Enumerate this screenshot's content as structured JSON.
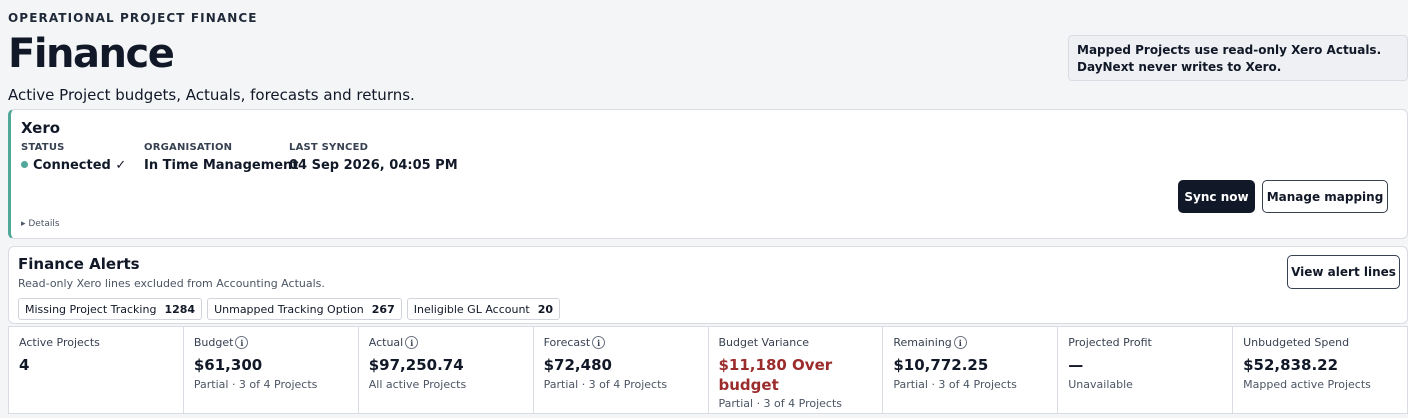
{
  "header": {
    "eyebrow": "OPERATIONAL PROJECT FINANCE",
    "title": "Finance",
    "subtitle": "Active Project budgets, Actuals, forecasts and returns.",
    "notice_line1": "Mapped Projects use read-only Xero Actuals.",
    "notice_line2": "DayNext never writes to Xero."
  },
  "xero": {
    "title": "Xero",
    "status_label": "STATUS",
    "status_value": "Connected ✓",
    "organisation_label": "ORGANISATION",
    "organisation_value": "In Time Management",
    "last_synced_label": "LAST SYNCED",
    "last_synced_value": "04 Sep 2026, 04:05 PM",
    "details_label": "▸ Details",
    "sync_button": "Sync now",
    "mapping_button": "Manage mapping",
    "accent_color": "#4fa89a"
  },
  "alerts": {
    "title": "Finance Alerts",
    "subtitle": "Read-only Xero lines excluded from Accounting Actuals.",
    "view_button": "View alert lines",
    "chips": [
      {
        "label": "Missing Project Tracking",
        "count": "1284"
      },
      {
        "label": "Unmapped Tracking Option",
        "count": "267"
      },
      {
        "label": "Ineligible GL Account",
        "count": "20"
      }
    ]
  },
  "metrics": [
    {
      "label": "Active Projects",
      "value": "4",
      "note": ""
    },
    {
      "label": "Budget",
      "value": "$61,300",
      "note": "Partial · 3 of 4 Projects"
    },
    {
      "label": "Actual",
      "value": "$97,250.74",
      "note": "All active Projects"
    },
    {
      "label": "Forecast",
      "value": "$72,480",
      "note": "Partial · 3 of 4 Projects"
    },
    {
      "label": "Budget Variance",
      "value": "$11,180 Over budget",
      "note": "Partial · 3 of 4 Projects"
    },
    {
      "label": "Remaining",
      "value": "$10,772.25",
      "note": "Partial · 3 of 4 Projects"
    },
    {
      "label": "Projected Profit",
      "value": "—",
      "note": "Unavailable"
    },
    {
      "label": "Unbudgeted Spend",
      "value": "$52,838.22",
      "note": "Mapped active Projects"
    }
  ],
  "colors": {
    "danger": "#9b2c2c",
    "dark_button": "#111827"
  }
}
